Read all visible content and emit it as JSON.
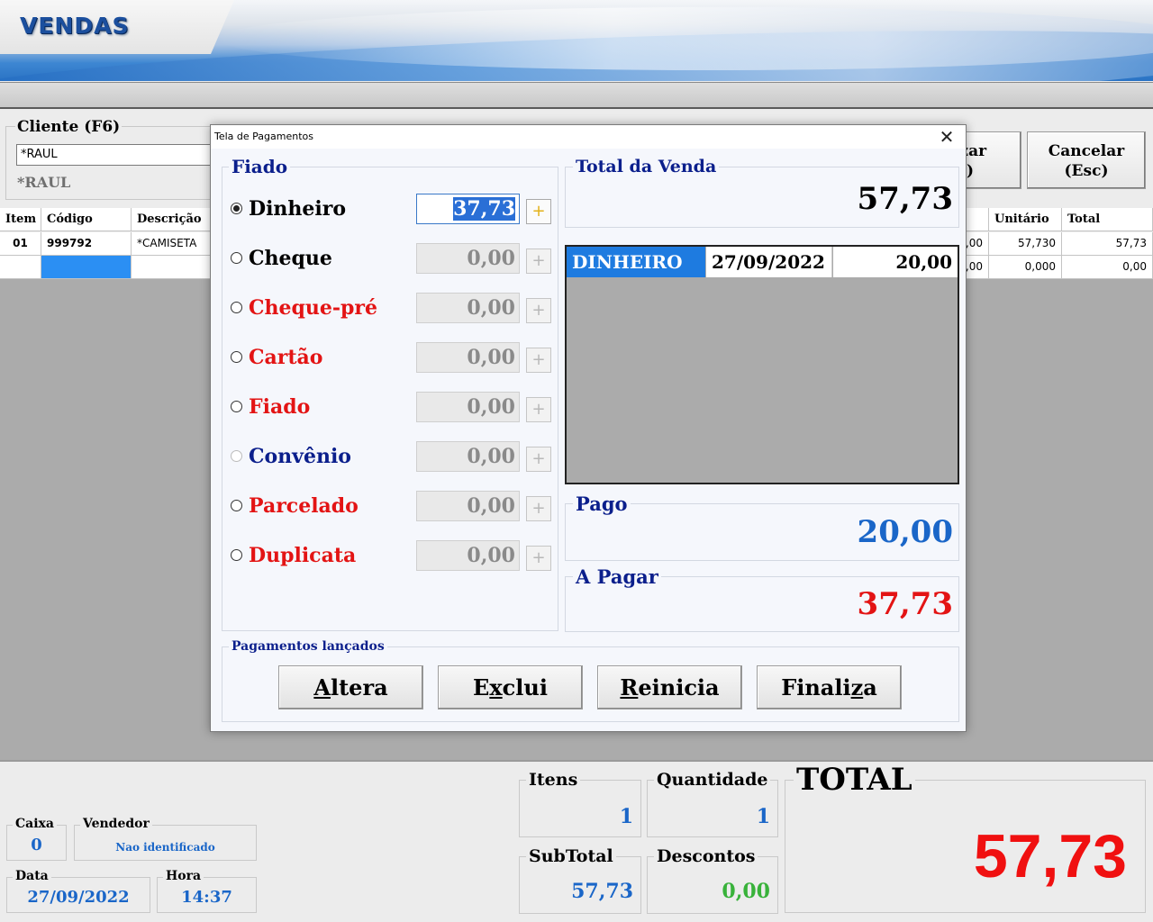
{
  "app": {
    "title": "VENDAS"
  },
  "client": {
    "label": "Cliente (F6)",
    "input_value": "*RAUL",
    "name": "*RAUL"
  },
  "buttons": {
    "finalizar": "izar\n)",
    "cancelar": "Cancelar\n(Esc)"
  },
  "items_table": {
    "headers": {
      "item": "Item",
      "codigo": "Código",
      "descricao": "Descrição",
      "qty_tail": ")",
      "unitario": "Unitário",
      "total": "Total"
    },
    "rows": [
      {
        "item": "01",
        "codigo": "999792",
        "descricao": "*CAMISETA",
        "qty_tail": ",00",
        "unitario": "57,730",
        "total": "57,73"
      },
      {
        "item": "",
        "codigo": "",
        "descricao": "",
        "qty_tail": ",00",
        "unitario": "0,000",
        "total": "0,00"
      }
    ]
  },
  "dialog": {
    "title": "Tela de Pagamentos",
    "close_glyph": "✕",
    "group_label": "Fiado",
    "payment_methods": [
      {
        "label": "Dinheiro",
        "value": "37,73",
        "color": "#000000",
        "checked": true
      },
      {
        "label": "Cheque",
        "value": "0,00",
        "color": "#000000"
      },
      {
        "label": "Cheque-pré",
        "value": "0,00",
        "color": "#e31414"
      },
      {
        "label": "Cartão",
        "value": "0,00",
        "color": "#e31414"
      },
      {
        "label": "Fiado",
        "value": "0,00",
        "color": "#e31414"
      },
      {
        "label": "Convênio",
        "value": "0,00",
        "color": "#0b1f8c"
      },
      {
        "label": "Parcelado",
        "value": "0,00",
        "color": "#e31414"
      },
      {
        "label": "Duplicata",
        "value": "0,00",
        "color": "#e31414"
      }
    ],
    "plus_glyph": "+",
    "total_venda": {
      "label": "Total da Venda",
      "value": "57,73"
    },
    "payments_list": [
      {
        "type": "DINHEIRO",
        "date": "27/09/2022",
        "amount": "20,00"
      }
    ],
    "pago": {
      "label": "Pago",
      "value": "20,00",
      "color": "#1a66c8"
    },
    "a_pagar": {
      "label": "A Pagar",
      "value": "37,73",
      "color": "#e31414"
    },
    "lancados_label": "Pagamentos lançados",
    "actions": [
      {
        "underline": "A",
        "rest": "ltera"
      },
      {
        "pre": "E",
        "underline": "x",
        "rest": "clui"
      },
      {
        "underline": "R",
        "rest": "einicia"
      },
      {
        "pre": "Finali",
        "underline": "z",
        "rest": "a"
      }
    ]
  },
  "status": {
    "caixa": {
      "label": "Caixa",
      "value": "0"
    },
    "vendedor": {
      "label": "Vendedor",
      "value": "Nao identificado"
    },
    "data": {
      "label": "Data",
      "value": "27/09/2022"
    },
    "hora": {
      "label": "Hora",
      "value": "14:37"
    },
    "itens": {
      "label": "Itens",
      "value": "1"
    },
    "quantidade": {
      "label": "Quantidade",
      "value": "1"
    },
    "subtotal": {
      "label": "SubTotal",
      "value": "57,73"
    },
    "descontos": {
      "label": "Descontos",
      "value": "0,00",
      "color": "#38b23a"
    },
    "total": {
      "label": "TOTAL",
      "value": "57,73",
      "color": "#f01010"
    }
  },
  "colors": {
    "accent_blue": "#1a66c8",
    "selection_blue": "#1e7be0",
    "title_navy": "#0b1f8c"
  }
}
